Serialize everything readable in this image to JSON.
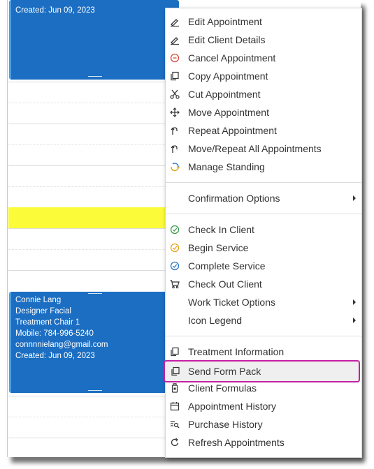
{
  "appointments": {
    "top": {
      "created": "Created: Jun 09, 2023"
    },
    "bottom": {
      "client": "Connie Lang",
      "service": "Designer Facial",
      "resource": "Treatment Chair 1",
      "mobile": "Mobile: 784-996-5240",
      "email": "connnnielang@gmail.com",
      "created": "Created: Jun 09, 2023"
    }
  },
  "colors": {
    "appointment_bg": "#1b6ec2",
    "highlight_row": "#fbfb3a",
    "highlight_border": "#c41fa4"
  },
  "menu": {
    "edit_appointment": "Edit Appointment",
    "edit_client_details": "Edit Client Details",
    "cancel_appointment": "Cancel Appointment",
    "copy_appointment": "Copy Appointment",
    "cut_appointment": "Cut Appointment",
    "move_appointment": "Move Appointment",
    "repeat_appointment": "Repeat Appointment",
    "move_repeat_all": "Move/Repeat All Appointments",
    "manage_standing": "Manage Standing",
    "confirmation_options": "Confirmation Options",
    "check_in_client": "Check In Client",
    "begin_service": "Begin Service",
    "complete_service": "Complete Service",
    "check_out_client": "Check Out Client",
    "work_ticket_options": "Work Ticket Options",
    "icon_legend": "Icon Legend",
    "treatment_information": "Treatment Information",
    "send_form_pack": "Send Form Pack",
    "client_formulas": "Client Formulas",
    "appointment_history": "Appointment History",
    "purchase_history": "Purchase History",
    "refresh_appointments": "Refresh Appointments"
  }
}
